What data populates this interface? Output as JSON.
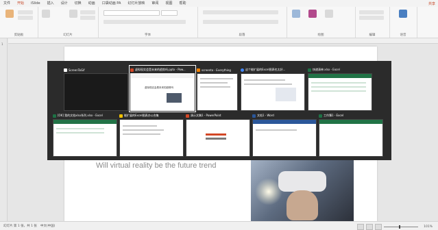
{
  "menu": {
    "tabs": [
      "文件",
      "开始",
      "iSlide",
      "插入",
      "设计",
      "切换",
      "动画",
      "口袋动画 PA",
      "幻灯片放映",
      "审阅",
      "视图",
      "帮助"
    ],
    "active_index": 1,
    "share": "共享"
  },
  "ribbon": {
    "groups": [
      "剪贴板",
      "幻灯片",
      "字体",
      "段落",
      "绘图",
      "编辑",
      "语音"
    ]
  },
  "slide": {
    "text": "Will virtual reality be the future trend",
    "thumb_caption": "虚拟现实会是未来的趋势吗"
  },
  "switcher": {
    "windows": [
      {
        "title": "ScreenToGif",
        "icon_color": "#ffffff",
        "kind": "dark"
      },
      {
        "title": "虚拟现实会是未来的趋势吗.pptx - Pow...",
        "icon_color": "#d24726",
        "kind": "ppt"
      },
      {
        "title": "screento - Everything",
        "icon_color": "#f08000",
        "kind": "list"
      },
      {
        "title": "这个能扩展的Excel图表也太好...",
        "icon_color": "#4285f4",
        "kind": "browser"
      },
      {
        "title": "快递清单.xlsx - Excel",
        "icon_color": "#1e7145",
        "kind": "excel"
      },
      {
        "title": "[OK] 我的文档xlsx系列.xlsx - Excel",
        "icon_color": "#1e7145",
        "kind": "excel"
      },
      {
        "title": "能扩展的Excel图表办公合集",
        "icon_color": "#f0c000",
        "kind": "folder"
      },
      {
        "title": "演示文稿1 - PowerPoint",
        "icon_color": "#d24726",
        "kind": "pptchart"
      },
      {
        "title": "文档1 - Word",
        "icon_color": "#2b579a",
        "kind": "word"
      },
      {
        "title": "工作簿1 - Excel",
        "icon_color": "#1e7145",
        "kind": "excel"
      }
    ],
    "selected_index": 1
  },
  "status": {
    "slide_info": "幻灯片 第 1 张，共 1 张",
    "language": "中文(中国)",
    "zoom": "101%"
  },
  "left_numbers": [
    "1"
  ]
}
